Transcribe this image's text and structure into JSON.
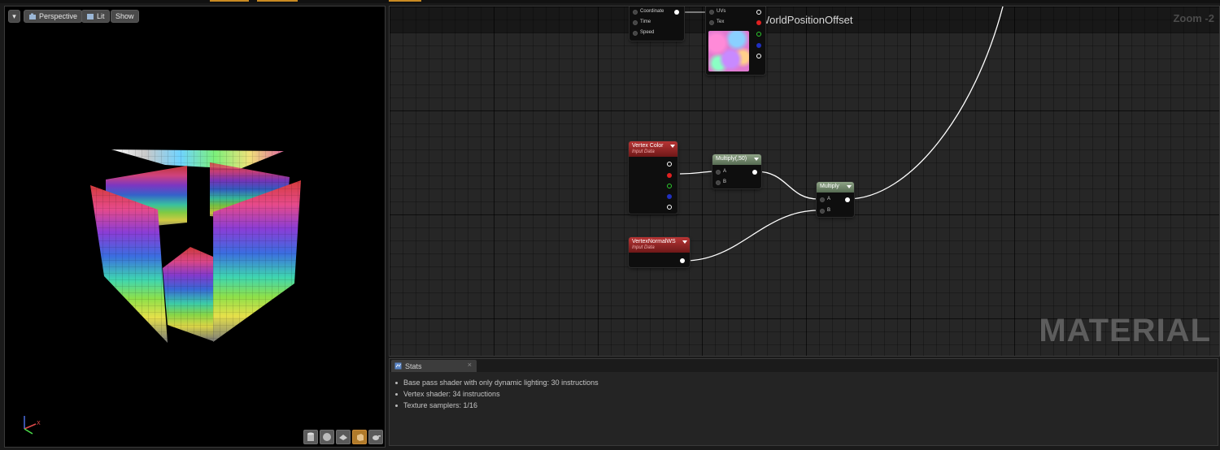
{
  "viewport": {
    "menu_label": "▾",
    "perspective_label": "Perspective",
    "lit_label": "Lit",
    "show_label": "Show",
    "tools": [
      "cylinder-icon",
      "sphere-icon",
      "plane-icon",
      "cube-icon",
      "teapot-icon"
    ]
  },
  "graph": {
    "title": "M_WorldPositionOffset",
    "zoom": "Zoom -2",
    "watermark": "MATERIAL",
    "nodes": {
      "panner": {
        "pins": [
          "Coordinate",
          "Time",
          "Speed"
        ]
      },
      "texture": {
        "pins": [
          "UVs",
          "Tex"
        ]
      },
      "vertex_color": {
        "title": "Vertex Color",
        "subtitle": "Input Data"
      },
      "multiply_50": {
        "title": "Multiply(,50)",
        "pins": [
          "A",
          "B"
        ]
      },
      "multiply": {
        "title": "Multiply",
        "pins": [
          "A",
          "B"
        ]
      },
      "vertex_normal": {
        "title": "VertexNormalWS",
        "subtitle": "Input Data"
      }
    }
  },
  "stats": {
    "tab_label": "Stats",
    "close_label": "×",
    "lines": [
      "Base pass shader with only dynamic lighting: 30 instructions",
      "Vertex shader: 34 instructions",
      "Texture samplers: 1/16"
    ]
  },
  "colors": {
    "accent_orange": "#c98a22",
    "node_red": "#b83535",
    "node_green": "#8fa487"
  }
}
